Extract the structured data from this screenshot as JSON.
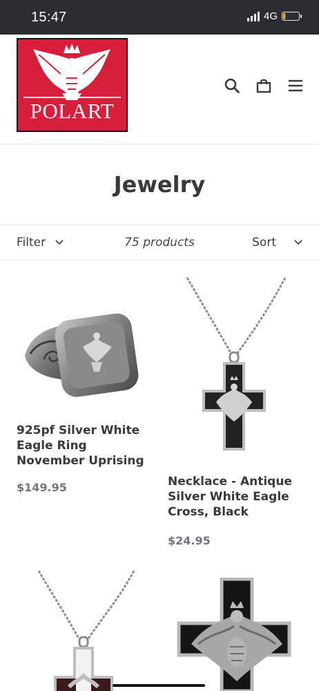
{
  "status_bar": {
    "time": "15:47",
    "network": "4G",
    "battery_fill_fraction": 0.12
  },
  "brand": {
    "logo_text": "POLART"
  },
  "header": {
    "icons": [
      "search-icon",
      "cart-icon",
      "menu-icon"
    ]
  },
  "page": {
    "title": "Jewelry"
  },
  "toolbar": {
    "filter_label": "Filter",
    "product_count": "75 products",
    "sort_label": "Sort"
  },
  "products": [
    {
      "title": "925pf Silver White Eagle Ring November Uprising",
      "price": "$149.95"
    },
    {
      "title": "Necklace - Antique Silver White Eagle Cross, Black",
      "price": "$24.95"
    },
    {
      "title": "",
      "price": ""
    },
    {
      "title": "",
      "price": ""
    }
  ]
}
